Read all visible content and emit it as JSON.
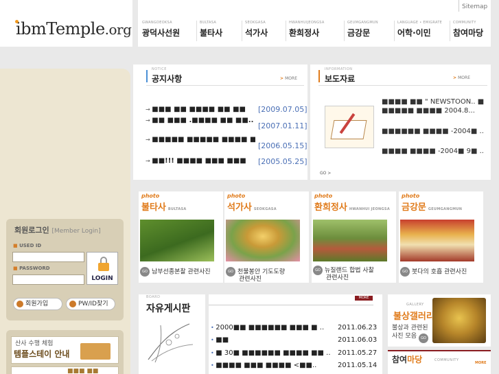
{
  "site": {
    "logo_main": "ibmTemple",
    "logo_suffix": ".org",
    "sitemap": "Sitemap"
  },
  "nav": [
    {
      "en": "GWANGDEOKSA",
      "ko": "광덕사선원"
    },
    {
      "en": "BULTASA",
      "ko": "불타사"
    },
    {
      "en": "SEOKGASA",
      "ko": "석가사"
    },
    {
      "en": "HWANHUIJEONGSA",
      "ko": "환희정사"
    },
    {
      "en": "GEUMGANGMUN",
      "ko": "금강문"
    },
    {
      "en": "LANGUAGE • EMIGRATE",
      "ko": "어학·이민"
    },
    {
      "en": "COMMUNITY",
      "ko": "참여마당"
    }
  ],
  "notice": {
    "en": "NOTICE",
    "ko": "공지사항",
    "more": "MORE",
    "items": [
      {
        "title": "■■■ ■■ ■■■■ ■■ ■■",
        "date": "[2009.07.05]"
      },
      {
        "title": "■■ ■■■ .■■■■ ■■ ■■..",
        "date": "[2007.01.11]"
      },
      {
        "title": "■■■■■ ■■■■■ ■■■■ ■..",
        "date": "[2006.05.15]"
      },
      {
        "title": "■■!!! ■■■■ ■■■ ■■■",
        "date": "[2005.05.25]"
      }
    ]
  },
  "info": {
    "en": "INFORMATION",
    "ko": "보도자료",
    "more": "MORE",
    "go": "GO",
    "items": [
      "■■■■ ■■ \" NEWSTOON.. ■■■■■■ ■■■■ 2004.8...",
      "■■■■■■ ■■■■ -2004■ ..",
      "■■■■ ■■■■ -2004■ 9■ .."
    ]
  },
  "photos": [
    {
      "tag": "photo",
      "ko": "불타사",
      "en": "BULTASA",
      "caption": [
        "남부선종본찰 관련사진"
      ]
    },
    {
      "tag": "photo",
      "ko": "석가사",
      "en": "SEOKGASA",
      "caption": [
        "천불봉안 기도도량",
        "관련사진"
      ]
    },
    {
      "tag": "photo",
      "ko": "환희정사",
      "en": "HWANHUI JEONGSA",
      "caption": [
        "뉴질랜드 합법 사찰",
        "관련사진"
      ]
    },
    {
      "tag": "photo",
      "ko": "금강문",
      "en": "GEUMGANGMUN",
      "caption": [
        "붓다의 호흡 관련사진"
      ]
    }
  ],
  "login": {
    "title": "회원로그인",
    "sub": "[Member Login]",
    "id_label": "USED ID",
    "pw_label": "PASSWORD",
    "button": "LOGIN",
    "join": "회원가입",
    "find": "PW/ID찾기"
  },
  "banner": {
    "line1": "산사 수행 체험",
    "line2": "템플스테이 안내",
    "line3": "■■■ ■■"
  },
  "board": {
    "en": "BOARD",
    "ko": "자유게시판",
    "more": "MORE",
    "items": [
      {
        "title": "2000■■ ■■■■■■ ■■■ ■ ..",
        "date": "2011.06.23"
      },
      {
        "title": "■■",
        "date": "2011.06.03"
      },
      {
        "title": "■ 30■ ■■■■■■ ■■■■ ■■ ..",
        "date": "2011.05.27"
      },
      {
        "title": "■■■■ ■■■ ■■■■ <■■..",
        "date": "2011.05.14"
      }
    ]
  },
  "gallery": {
    "en": "GALLERY",
    "ko": "불상갤러리",
    "caption": "불상과 관련된 사진 모음"
  },
  "participate": {
    "ko_a": "참여",
    "ko_b": "마당",
    "en": "COMMUNITY",
    "more": "MORE"
  },
  "colors": {
    "accent": "#e07b1b",
    "date_blue": "#4a6fb5",
    "dark_red": "#8a1c20",
    "left_bg": "#ede6d2"
  }
}
